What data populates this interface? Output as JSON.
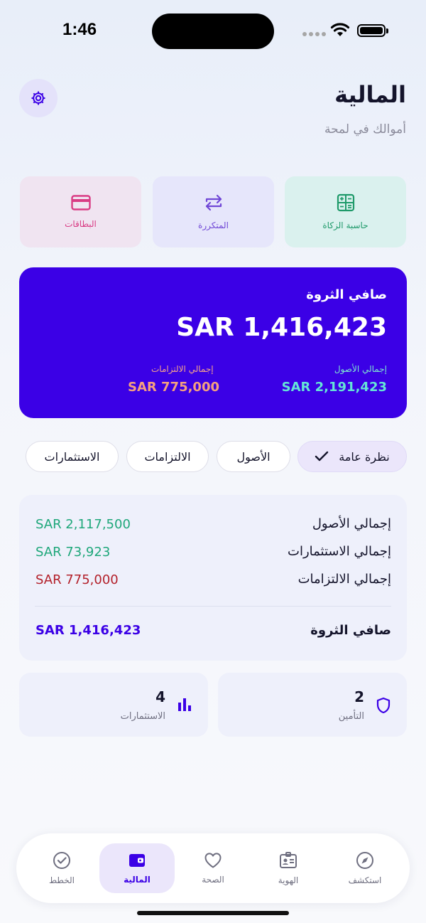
{
  "status_bar": {
    "time": "1:46"
  },
  "header": {
    "title": "المالية",
    "subtitle": "أموالك في لمحة"
  },
  "quick_actions": [
    {
      "label": "حاسبة الزكاة",
      "icon": "calculator-icon",
      "color": "#1f9a6a"
    },
    {
      "label": "المتكررة",
      "icon": "repeat-icon",
      "color": "#7047d6"
    },
    {
      "label": "البطاقات",
      "icon": "credit-card-icon",
      "color": "#d93b84"
    }
  ],
  "net_worth_card": {
    "label": "صافي الثروة",
    "value": "SAR 1,416,423",
    "assets_label": "إجمالي الأصول",
    "assets_value": "SAR 2,191,423",
    "liabilities_label": "إجمالي الالتزامات",
    "liabilities_value": "SAR 775,000",
    "background": "#3b00e6"
  },
  "tabs": [
    {
      "label": "نظرة عامة",
      "selected": true
    },
    {
      "label": "الأصول"
    },
    {
      "label": "الالتزامات"
    },
    {
      "label": "الاستثمارات"
    }
  ],
  "summary": {
    "rows": [
      {
        "label": "إجمالي الأصول",
        "value": "SAR 2,117,500"
      },
      {
        "label": "إجمالي الاستثمارات",
        "value": "SAR 73,923"
      },
      {
        "label": "إجمالي الالتزامات",
        "value": "SAR 775,000"
      }
    ],
    "net_worth_label": "صافي الثروة",
    "net_worth_value": "SAR 1,416,423"
  },
  "stats": {
    "insurance": {
      "value": "2",
      "label": "التأمين",
      "icon": "shield-icon"
    },
    "investments": {
      "value": "4",
      "label": "الاستثمارات",
      "icon": "bar-chart-icon"
    }
  },
  "bottom_nav": [
    {
      "label": "استكشف",
      "icon": "compass-icon"
    },
    {
      "label": "الهوية",
      "icon": "id-badge-icon"
    },
    {
      "label": "الصحة",
      "icon": "heart-icon"
    },
    {
      "label": "المالية",
      "icon": "wallet-icon",
      "active": true
    },
    {
      "label": "الخطط",
      "icon": "check-circle-icon"
    }
  ]
}
